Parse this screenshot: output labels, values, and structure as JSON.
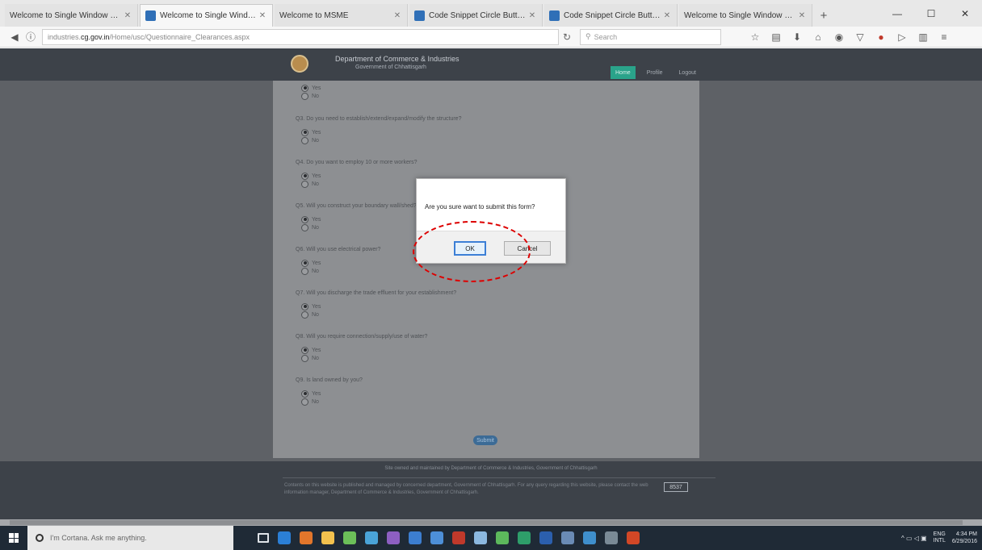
{
  "browser": {
    "tabs": [
      {
        "label": "Welcome to Single Window Sy...",
        "active": false,
        "has_icon": false
      },
      {
        "label": "Welcome to Single Windo...",
        "active": true,
        "has_icon": true
      },
      {
        "label": "Welcome to MSME",
        "active": false,
        "has_icon": false
      },
      {
        "label": "Code Snippet Circle Butto...",
        "active": false,
        "has_icon": true
      },
      {
        "label": "Code Snippet Circle Butto...",
        "active": false,
        "has_icon": true
      },
      {
        "label": "Welcome to Single Window Sy...",
        "active": false,
        "has_icon": false
      }
    ],
    "new_tab_glyph": "+",
    "window_controls": {
      "minimize": "—",
      "maximize": "☐",
      "close": "✕"
    },
    "url_prefix": "industries.",
    "url_domain": "cg.gov.in",
    "url_path": "/Home/usc/Questionnaire_Clearances.aspx",
    "search_placeholder": "Search",
    "toolbar_icons": [
      "star-icon",
      "reading-list-icon",
      "download-icon",
      "home-icon",
      "sync-icon",
      "pocket-icon",
      "addon-icon",
      "extension-icon",
      "menu-icon"
    ]
  },
  "site": {
    "department": "Department of Commerce & Industries",
    "government": "Government of Chhattisgarh",
    "nav": [
      {
        "label": "Home",
        "active": true
      },
      {
        "label": "Profile",
        "active": false
      },
      {
        "label": "Logout",
        "active": false
      }
    ]
  },
  "questionnaire": {
    "questions": [
      {
        "text": "",
        "options": [
          "Yes",
          "No"
        ],
        "selected": 0
      },
      {
        "text": "Q3. Do you need to establish/extend/expand/modify the structure?",
        "options": [
          "Yes",
          "No"
        ],
        "selected": 0
      },
      {
        "text": "Q4. Do you want to employ 10 or more workers?",
        "options": [
          "Yes",
          "No"
        ],
        "selected": 0
      },
      {
        "text": "Q5. Will you construct your boundary wall/shed?",
        "options": [
          "Yes",
          "No"
        ],
        "selected": 0
      },
      {
        "text": "Q6. Will you use electrical power?",
        "options": [
          "Yes",
          "No"
        ],
        "selected": 0
      },
      {
        "text": "Q7. Will you discharge the trade effluent for your establishment?",
        "options": [
          "Yes",
          "No"
        ],
        "selected": 0
      },
      {
        "text": "Q8. Will you require connection/supply/use of water?",
        "options": [
          "Yes",
          "No"
        ],
        "selected": 0
      },
      {
        "text": "Q9. Is land owned by you?",
        "options": [
          "Yes",
          "No"
        ],
        "selected": 0
      }
    ],
    "submit_label": "Submit"
  },
  "footer": {
    "line1": "Site owned and maintained by Department of Commerce & Industries, Government of Chhattisgarh",
    "text": "Contents on this website is published and managed by concerned department, Government of Chhattisgarh. For any query regarding this website, please contact the web information manager, Department of Commerce & Industries, Government of Chhattisgarh.",
    "visits": "8537"
  },
  "dialog": {
    "message": "Are you sure want to submit this form?",
    "ok_label": "OK",
    "cancel_label": "Cancel"
  },
  "taskbar": {
    "cortana_placeholder": "I'm Cortana. Ask me anything.",
    "apps": [
      {
        "name": "task-view-icon",
        "color": "#1f2a36"
      },
      {
        "name": "edge-icon",
        "color": "#2b7fd6"
      },
      {
        "name": "firefox-icon",
        "color": "#e2762b"
      },
      {
        "name": "file-explorer-icon",
        "color": "#f2c14e"
      },
      {
        "name": "chrome-icon",
        "color": "#6bbf59"
      },
      {
        "name": "app-icon-1",
        "color": "#4aa3d8"
      },
      {
        "name": "visual-studio-icon",
        "color": "#8d5fc2"
      },
      {
        "name": "app-icon-2",
        "color": "#3c7ed0"
      },
      {
        "name": "app-icon-3",
        "color": "#4d8fd8"
      },
      {
        "name": "filezilla-icon",
        "color": "#c0392b"
      },
      {
        "name": "app-icon-4",
        "color": "#8bb8e0"
      },
      {
        "name": "app-icon-5",
        "color": "#5cb85c"
      },
      {
        "name": "app-icon-6",
        "color": "#2e9e6a"
      },
      {
        "name": "word-icon",
        "color": "#2b5fad"
      },
      {
        "name": "app-icon-7",
        "color": "#6a8bb5"
      },
      {
        "name": "app-icon-8",
        "color": "#3f8fcc"
      },
      {
        "name": "app-icon-9",
        "color": "#7a8a96"
      },
      {
        "name": "powerpoint-icon",
        "color": "#d24726"
      }
    ],
    "tray_glyphs": "^ ▭ ◁ ▣",
    "language_top": "ENG",
    "language_bottom": "INTL",
    "time": "4:34 PM",
    "date": "6/29/2016"
  },
  "colors": {
    "accent": "#2aa38a",
    "highlight": "#dd0000"
  }
}
